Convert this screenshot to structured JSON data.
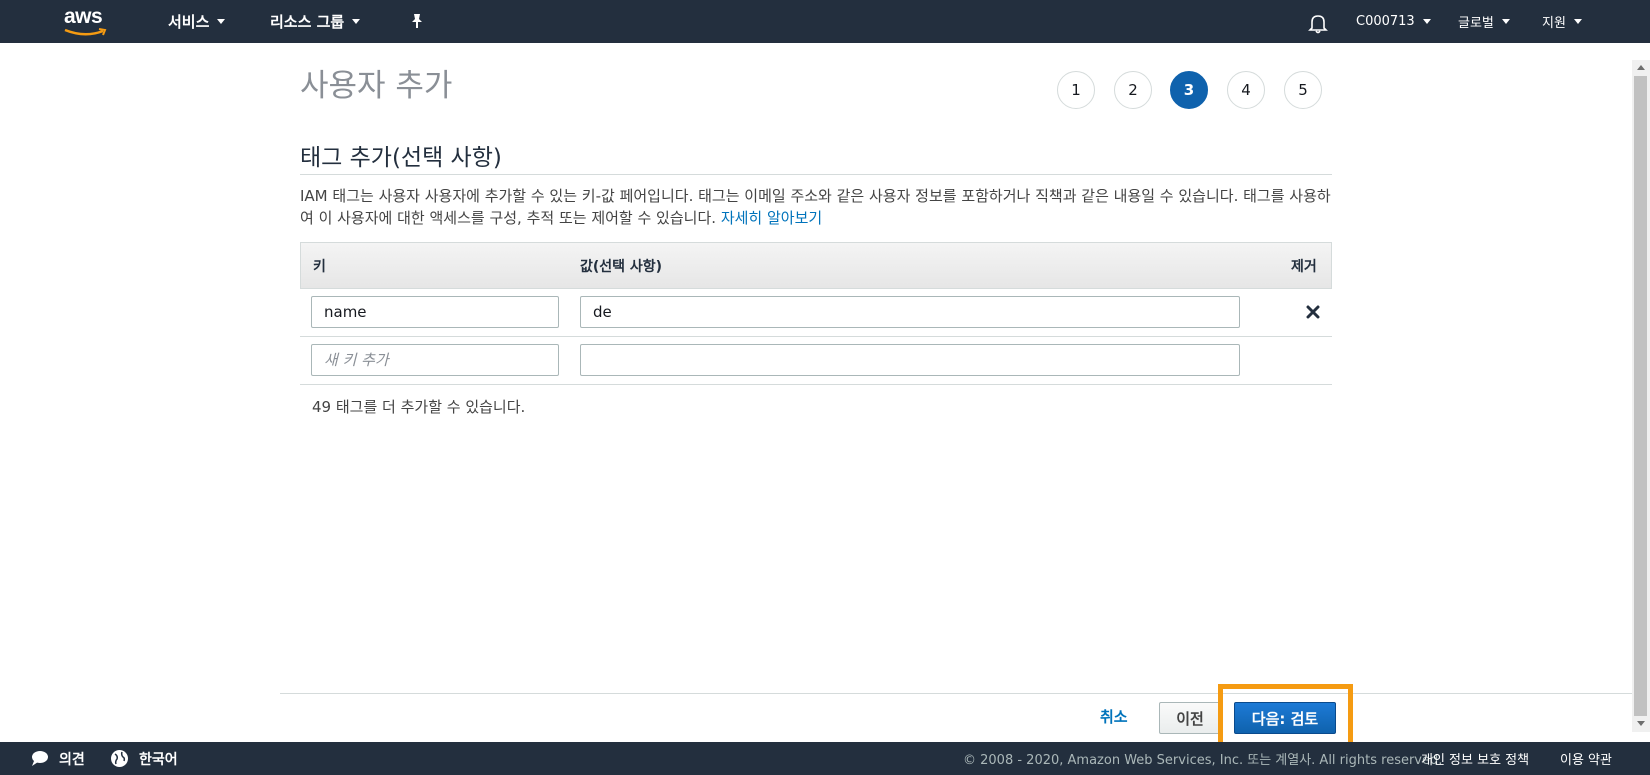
{
  "topnav": {
    "logo_text": "aws",
    "services": "서비스",
    "resource_groups": "리소스 그룹",
    "account": "C000713",
    "region": "글로벌",
    "support": "지원"
  },
  "page": {
    "title": "사용자 추가",
    "steps": [
      "1",
      "2",
      "3",
      "4",
      "5"
    ],
    "active_step": "3"
  },
  "section": {
    "heading": "태그 추가(선택 사항)",
    "description": "IAM 태그는 사용자 사용자에 추가할 수 있는 키-값 페어입니다. 태그는 이메일 주소와 같은 사용자 정보를 포함하거나 직책과 같은 내용일 수 있습니다. 태그를 사용하여 이 사용자에 대한 액세스를 구성, 추적 또는 제어할 수 있습니다.",
    "learn_more": "자세히 알아보기"
  },
  "table": {
    "headers": {
      "key": "키",
      "value": "값(선택 사항)",
      "remove": "제거"
    },
    "rows": [
      {
        "key": "name",
        "value": "de"
      }
    ],
    "new_row": {
      "key_placeholder": "새 키 추가",
      "value": ""
    },
    "remaining": "49 태그를 더 추가할 수 있습니다."
  },
  "actions": {
    "cancel": "취소",
    "previous": "이전",
    "next": "다음: 검토"
  },
  "footer": {
    "feedback": "의견",
    "language": "한국어",
    "copyright": "© 2008 - 2020, Amazon Web Services, Inc. 또는 계열사. All rights reserved.",
    "privacy": "개인 정보 보호 정책",
    "terms": "이용 약관"
  },
  "colors": {
    "nav_bg": "#232f3e",
    "primary": "#0f62ad",
    "link": "#0073bb",
    "highlight": "#f59b12"
  }
}
